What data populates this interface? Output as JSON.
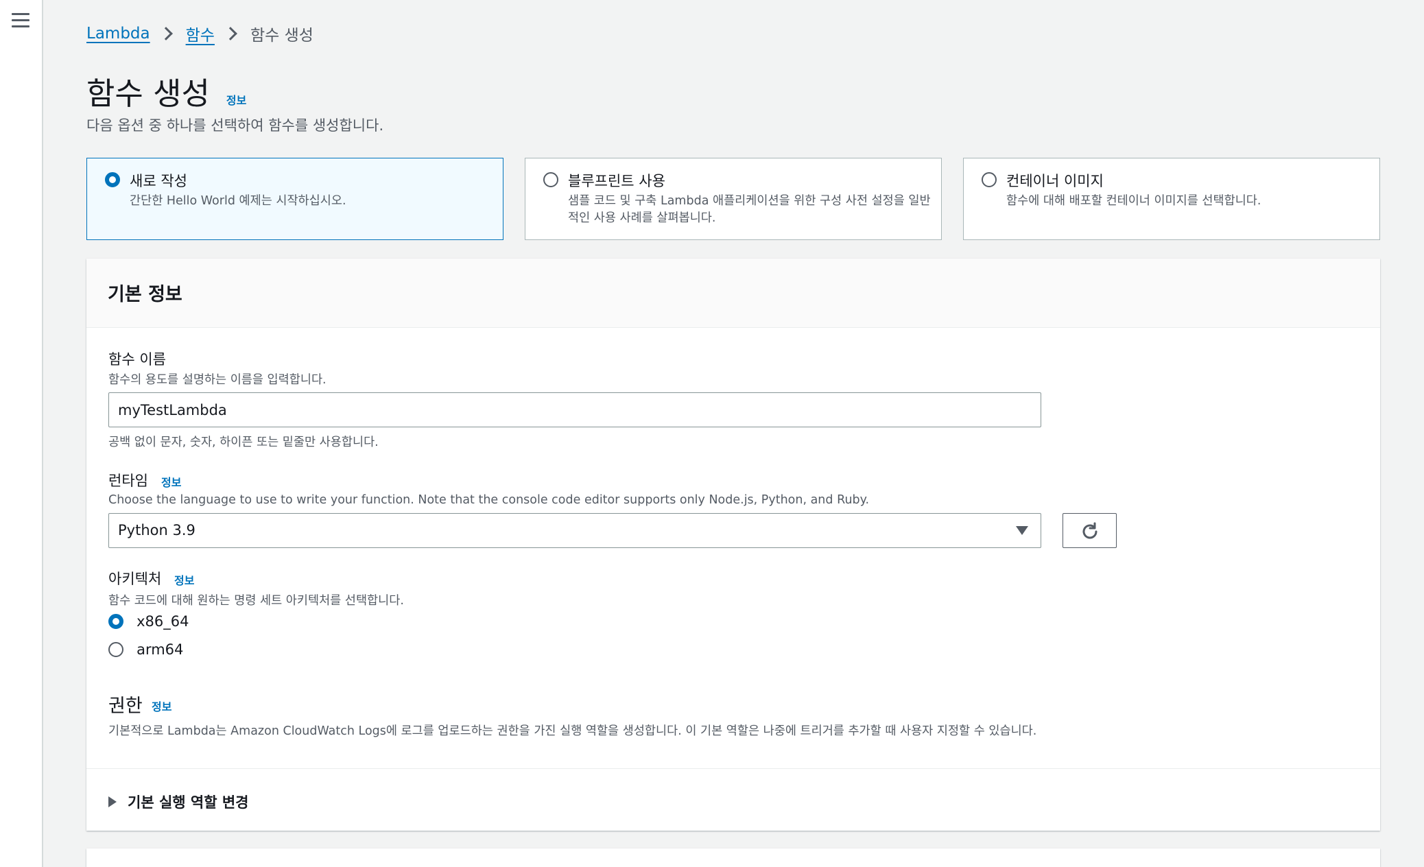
{
  "breadcrumb": {
    "items": [
      {
        "label": "Lambda"
      },
      {
        "label": "함수"
      },
      {
        "label": "함수 생성"
      }
    ]
  },
  "page": {
    "title": "함수 생성",
    "info_label": "정보",
    "description": "다음 옵션 중 하나를 선택하여 함수를 생성합니다."
  },
  "options": [
    {
      "title": "새로 작성",
      "description": "간단한 Hello World 예제는 시작하십시오.",
      "selected": true
    },
    {
      "title": "블루프린트 사용",
      "description": "샘플 코드 및 구축 Lambda 애플리케이션을 위한 구성 사전 설정을 일반적인 사용 사례를 살펴봅니다.",
      "selected": false
    },
    {
      "title": "컨테이너 이미지",
      "description": "함수에 대해 배포할 컨테이너 이미지를 선택합니다.",
      "selected": false
    }
  ],
  "basic_info": {
    "title": "기본 정보",
    "function_name": {
      "label": "함수 이름",
      "description": "함수의 용도를 설명하는 이름을 입력합니다.",
      "value": "myTestLambda",
      "constraint": "공백 없이 문자, 숫자, 하이픈 또는 밑줄만 사용합니다."
    },
    "runtime": {
      "label": "런타임",
      "info_label": "정보",
      "description": "Choose the language to use to write your function. Note that the console code editor supports only Node.js, Python, and Ruby.",
      "value": "Python 3.9"
    },
    "architecture": {
      "label": "아키텍처",
      "info_label": "정보",
      "description": "함수 코드에 대해 원하는 명령 세트 아키텍처를 선택합니다.",
      "options": [
        {
          "label": "x86_64",
          "selected": true
        },
        {
          "label": "arm64",
          "selected": false
        }
      ]
    },
    "permissions": {
      "title": "권한",
      "info_label": "정보",
      "description": "기본적으로 Lambda는 Amazon CloudWatch Logs에 로그를 업로드하는 권한을 가진 실행 역할을 생성합니다. 이 기본 역할은 나중에 트리거를 추가할 때 사용자 지정할 수 있습니다."
    },
    "expand_label": "기본 실행 역할 변경"
  },
  "icons": {
    "menu": "hamburger-menu-icon",
    "refresh": "refresh-icon",
    "dropdown": "caret-down-icon",
    "expand": "caret-right-icon"
  },
  "colors": {
    "link": "#0073bb",
    "selected_bg": "#f1faff",
    "page_bg": "#f2f3f3"
  }
}
